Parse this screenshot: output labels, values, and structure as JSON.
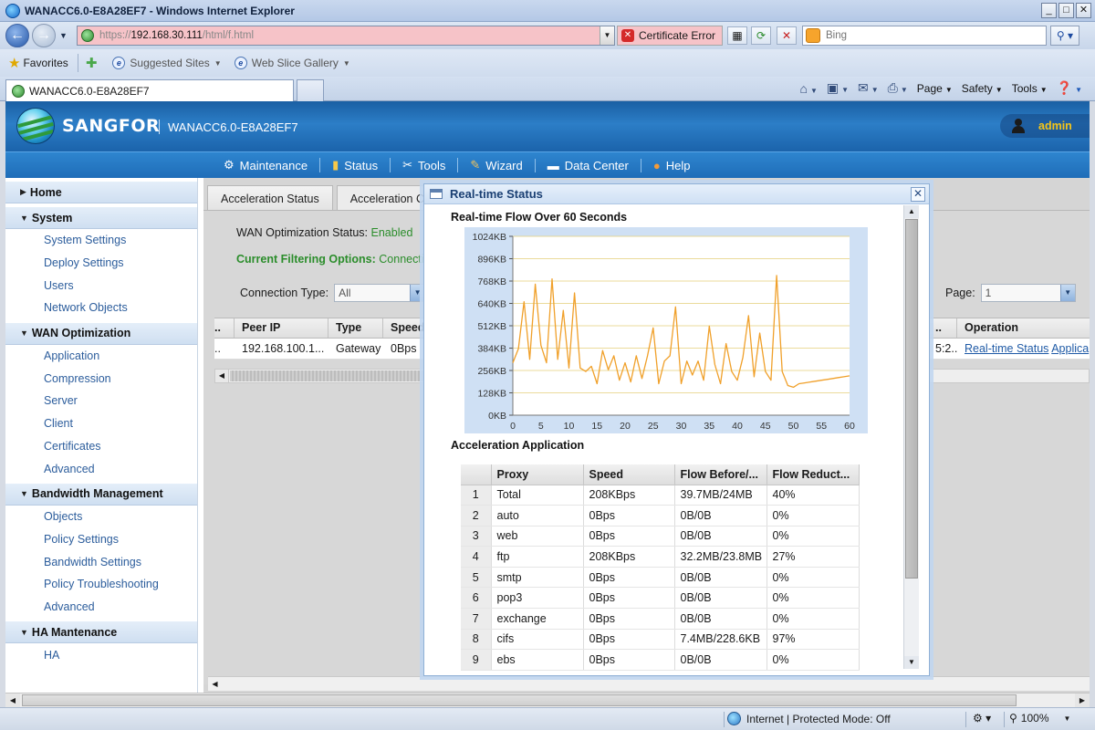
{
  "browser": {
    "window_title": "WANACC6.0-E8A28EF7 - Windows Internet Explorer",
    "url_prefix": "https://",
    "url_host": "192.168.30.111",
    "url_path": "/html/f.html",
    "cert_error": "Certificate Error",
    "search_placeholder": "Bing",
    "favorites_label": "Favorites",
    "fav_items": [
      "Suggested Sites",
      "Web Slice Gallery"
    ],
    "tab_title": "WANACC6.0-E8A28EF7",
    "command_items": [
      "Page",
      "Safety",
      "Tools"
    ],
    "status_zone": "Internet | Protected Mode: Off",
    "zoom": "100%"
  },
  "app": {
    "brand": "SANGFOR",
    "device_name": "WANACC6.0-E8A28EF7",
    "user": "admin",
    "nav": [
      {
        "label": "Maintenance",
        "icon": "gear-icon"
      },
      {
        "label": "Status",
        "icon": "bar-chart-icon"
      },
      {
        "label": "Tools",
        "icon": "tools-icon"
      },
      {
        "label": "Wizard",
        "icon": "wand-icon"
      },
      {
        "label": "Data Center",
        "icon": "folder-icon"
      },
      {
        "label": "Help",
        "icon": "help-icon"
      }
    ],
    "sidebar": {
      "home": "Home",
      "system": {
        "label": "System",
        "items": [
          "System Settings",
          "Deploy Settings",
          "Users",
          "Network Objects"
        ]
      },
      "wan": {
        "label": "WAN Optimization",
        "items": [
          "Application",
          "Compression",
          "Server",
          "Client",
          "Certificates",
          "Advanced"
        ]
      },
      "bandwidth": {
        "label": "Bandwidth Management",
        "items": [
          "Objects",
          "Policy Settings",
          "Bandwidth Settings",
          "Policy Troubleshooting",
          "Advanced"
        ]
      },
      "ha": {
        "label": "HA Mantenance",
        "items": [
          "HA"
        ]
      }
    }
  },
  "main": {
    "tabs": [
      "Acceleration Status",
      "Acceleration C"
    ],
    "wan_status_label": "WAN Optimization Status:",
    "wan_status_value": "Enabled",
    "filter_label": "Current Filtering Options:",
    "filter_value": "Connecti",
    "conn_type_label": "Connection Type:",
    "conn_type_value": "All",
    "page_label": "Page:",
    "page_value": "1",
    "columns": [
      "..",
      "Peer IP",
      "Type",
      "Speed",
      "..",
      "Operation"
    ],
    "row": {
      "col0": "..",
      "peer_ip": "192.168.100.1...",
      "type": "Gateway",
      "speed": "0Bps",
      "col4": "5:2...",
      "op1": "Real-time Status",
      "op2": "Applica"
    }
  },
  "modal": {
    "title": "Real-time Status",
    "chart_section": "Real-time Flow Over 60 Seconds",
    "table_section": "Acceleration Application",
    "table_headers": [
      "",
      "Proxy",
      "Speed",
      "Flow Before/...",
      "Flow Reduct..."
    ],
    "table_rows": [
      [
        "1",
        "Total",
        "208KBps",
        "39.7MB/24MB",
        "40%"
      ],
      [
        "2",
        "auto",
        "0Bps",
        "0B/0B",
        "0%"
      ],
      [
        "3",
        "web",
        "0Bps",
        "0B/0B",
        "0%"
      ],
      [
        "4",
        "ftp",
        "208KBps",
        "32.2MB/23.8MB",
        "27%"
      ],
      [
        "5",
        "smtp",
        "0Bps",
        "0B/0B",
        "0%"
      ],
      [
        "6",
        "pop3",
        "0Bps",
        "0B/0B",
        "0%"
      ],
      [
        "7",
        "exchange",
        "0Bps",
        "0B/0B",
        "0%"
      ],
      [
        "8",
        "cifs",
        "0Bps",
        "7.4MB/228.6KB",
        "97%"
      ],
      [
        "9",
        "ebs",
        "0Bps",
        "0B/0B",
        "0%"
      ]
    ]
  },
  "chart_data": {
    "type": "line",
    "title": "Real-time Flow Over 60 Seconds",
    "xlabel": "",
    "ylabel": "",
    "xlim": [
      0,
      60
    ],
    "ylim": [
      0,
      1024
    ],
    "x_ticks": [
      "0",
      "5",
      "10",
      "15",
      "20",
      "25",
      "30",
      "35",
      "40",
      "45",
      "50",
      "55",
      "60"
    ],
    "y_ticks": [
      "0KB",
      "128KB",
      "256KB",
      "384KB",
      "512KB",
      "640KB",
      "768KB",
      "896KB",
      "1024KB"
    ],
    "grid": true,
    "line_color": "#f0a02a",
    "series": [
      {
        "x": [
          0,
          1,
          2,
          3,
          4,
          5,
          6,
          7,
          8,
          9,
          10,
          11,
          12,
          13,
          14,
          15,
          16,
          17,
          18,
          19,
          20,
          21,
          22,
          23,
          24,
          25,
          26,
          27,
          28,
          29,
          30,
          31,
          32,
          33,
          34,
          35,
          36,
          37,
          38,
          39,
          40,
          41,
          42,
          43,
          44,
          45,
          46,
          47,
          48,
          49,
          50,
          51,
          52,
          53,
          54,
          55,
          56,
          57,
          58,
          59,
          60
        ],
        "values": [
          300,
          380,
          650,
          320,
          750,
          400,
          300,
          780,
          320,
          600,
          270,
          700,
          270,
          250,
          280,
          180,
          370,
          260,
          340,
          200,
          300,
          190,
          340,
          210,
          340,
          500,
          180,
          310,
          340,
          620,
          180,
          310,
          230,
          310,
          200,
          510,
          290,
          180,
          410,
          250,
          200,
          330,
          570,
          220,
          470,
          250,
          200,
          800,
          250,
          170,
          160,
          180,
          185,
          190,
          195,
          200,
          205,
          210,
          215,
          220,
          225
        ]
      }
    ]
  }
}
